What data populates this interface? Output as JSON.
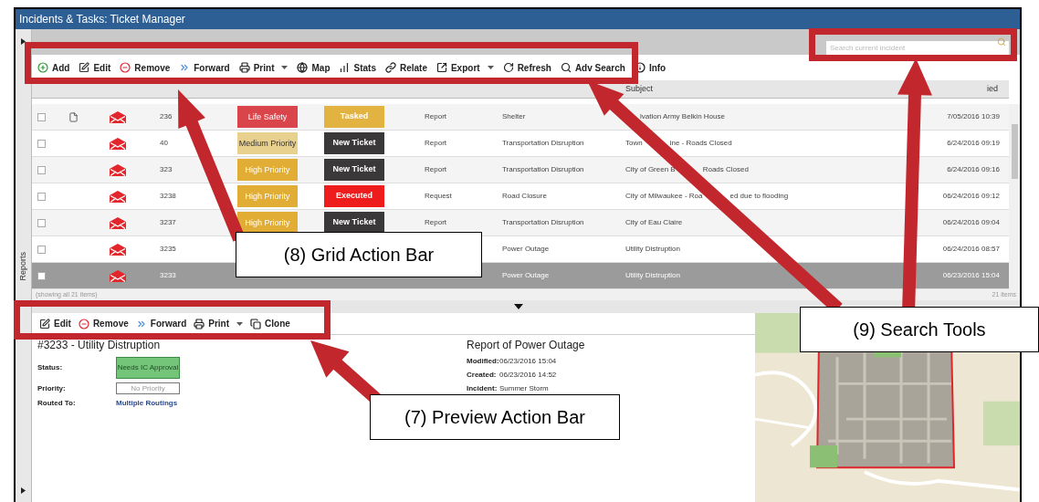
{
  "window": {
    "title": "Incidents & Tasks: Ticket Manager"
  },
  "search": {
    "placeholder": "Search current incident"
  },
  "side_tab": "Reports",
  "toolbar": [
    {
      "label": "Add",
      "dropdown": false
    },
    {
      "label": "Edit",
      "dropdown": false
    },
    {
      "label": "Remove",
      "dropdown": false
    },
    {
      "label": "Forward",
      "dropdown": false
    },
    {
      "label": "Print",
      "dropdown": true
    },
    {
      "label": "Map",
      "dropdown": false
    },
    {
      "label": "Stats",
      "dropdown": false
    },
    {
      "label": "Relate",
      "dropdown": false
    },
    {
      "label": "Export",
      "dropdown": true
    },
    {
      "label": "Refresh",
      "dropdown": false
    },
    {
      "label": "Adv Search",
      "dropdown": false
    },
    {
      "label": "Info",
      "dropdown": false
    }
  ],
  "table": {
    "columns": [
      "Subject",
      "ied"
    ],
    "rows": [
      {
        "checked": false,
        "document": true,
        "id": "236",
        "priority": {
          "text": "Life Safety",
          "color": "#d9454a"
        },
        "status": {
          "text": "Tasked",
          "color": "#e3b341"
        },
        "type": "Report",
        "category": "Shelter",
        "subject": [
          "lvation Army Belkin House"
        ],
        "modified": "7/05/2016 10:39",
        "selected": false
      },
      {
        "checked": false,
        "document": false,
        "id": "40",
        "priority": {
          "text": "Medium Priority",
          "color": "#e8d08e"
        },
        "status": {
          "text": "New Ticket",
          "color": "#3b3839"
        },
        "type": "Report",
        "category": "Transportation Disruption",
        "subject": [
          "Town",
          "ine - Roads Closed"
        ],
        "modified": "6/24/2016 09:19",
        "selected": false
      },
      {
        "checked": false,
        "document": false,
        "id": "323",
        "priority": {
          "text": "High Priority",
          "color": "#e2ad34"
        },
        "status": {
          "text": "New Ticket",
          "color": "#3b3839"
        },
        "type": "Report",
        "category": "Transportation Disruption",
        "subject": [
          "City of Green B",
          "Roads Closed"
        ],
        "modified": "6/24/2016 09:16",
        "selected": false
      },
      {
        "checked": false,
        "document": false,
        "id": "3238",
        "priority": {
          "text": "High Priority",
          "color": "#e2ad34"
        },
        "status": {
          "text": "Executed",
          "color": "#ee1c1c"
        },
        "type": "Request",
        "category": "Road Closure",
        "subject": [
          "City of Milwaukee - Roa",
          "ed due to flooding"
        ],
        "modified": "06/24/2016 09:12",
        "selected": false
      },
      {
        "checked": false,
        "document": false,
        "id": "3237",
        "priority": {
          "text": "High Priority",
          "color": "#e2ad34"
        },
        "status": {
          "text": "New Ticket",
          "color": "#3b3839"
        },
        "type": "Report",
        "category": "Transportation Disruption",
        "subject": [
          "City of Eau Claire"
        ],
        "modified": "06/24/2016 09:04",
        "selected": false
      },
      {
        "checked": false,
        "document": false,
        "id": "3235",
        "category": "Power Outage",
        "subject": [
          "Utility Distruption"
        ],
        "modified": "06/24/2016 08:57",
        "selected": false
      },
      {
        "checked": false,
        "document": false,
        "id": "3233",
        "category": "Power Outage",
        "subject": [
          "Utility Distruption"
        ],
        "modified": "06/23/2016 15:04",
        "selected": true
      }
    ],
    "footer_left": "(showing all 21 items)",
    "footer_right": "21 items"
  },
  "preview": {
    "toolbar": [
      {
        "label": "Edit",
        "dropdown": false
      },
      {
        "label": "Remove",
        "dropdown": false
      },
      {
        "label": "Forward",
        "dropdown": false
      },
      {
        "label": "Print",
        "dropdown": true
      },
      {
        "label": "Clone",
        "dropdown": false
      }
    ],
    "title": "#3233 - Utility Distruption",
    "fields": [
      {
        "label": "Status:",
        "value": "Needs IC Approval",
        "kind": "badge"
      },
      {
        "label": "Priority:",
        "value": "No Priority",
        "kind": "outlined"
      },
      {
        "label": "Routed To:",
        "value": "Multiple Routings",
        "kind": "link"
      }
    ],
    "report_title": "Report of Power Outage",
    "details": [
      {
        "label": "Modified:",
        "value": "06/23/2016 15:04"
      },
      {
        "label": "Created:",
        "value": "06/23/2016 14:52"
      },
      {
        "label": "Incident:",
        "value": "Summer Storm"
      }
    ]
  },
  "callouts": [
    {
      "text": "(8) Grid Action Bar"
    },
    {
      "text": "(9) Search Tools"
    },
    {
      "text": "(7) Preview Action Bar"
    }
  ]
}
